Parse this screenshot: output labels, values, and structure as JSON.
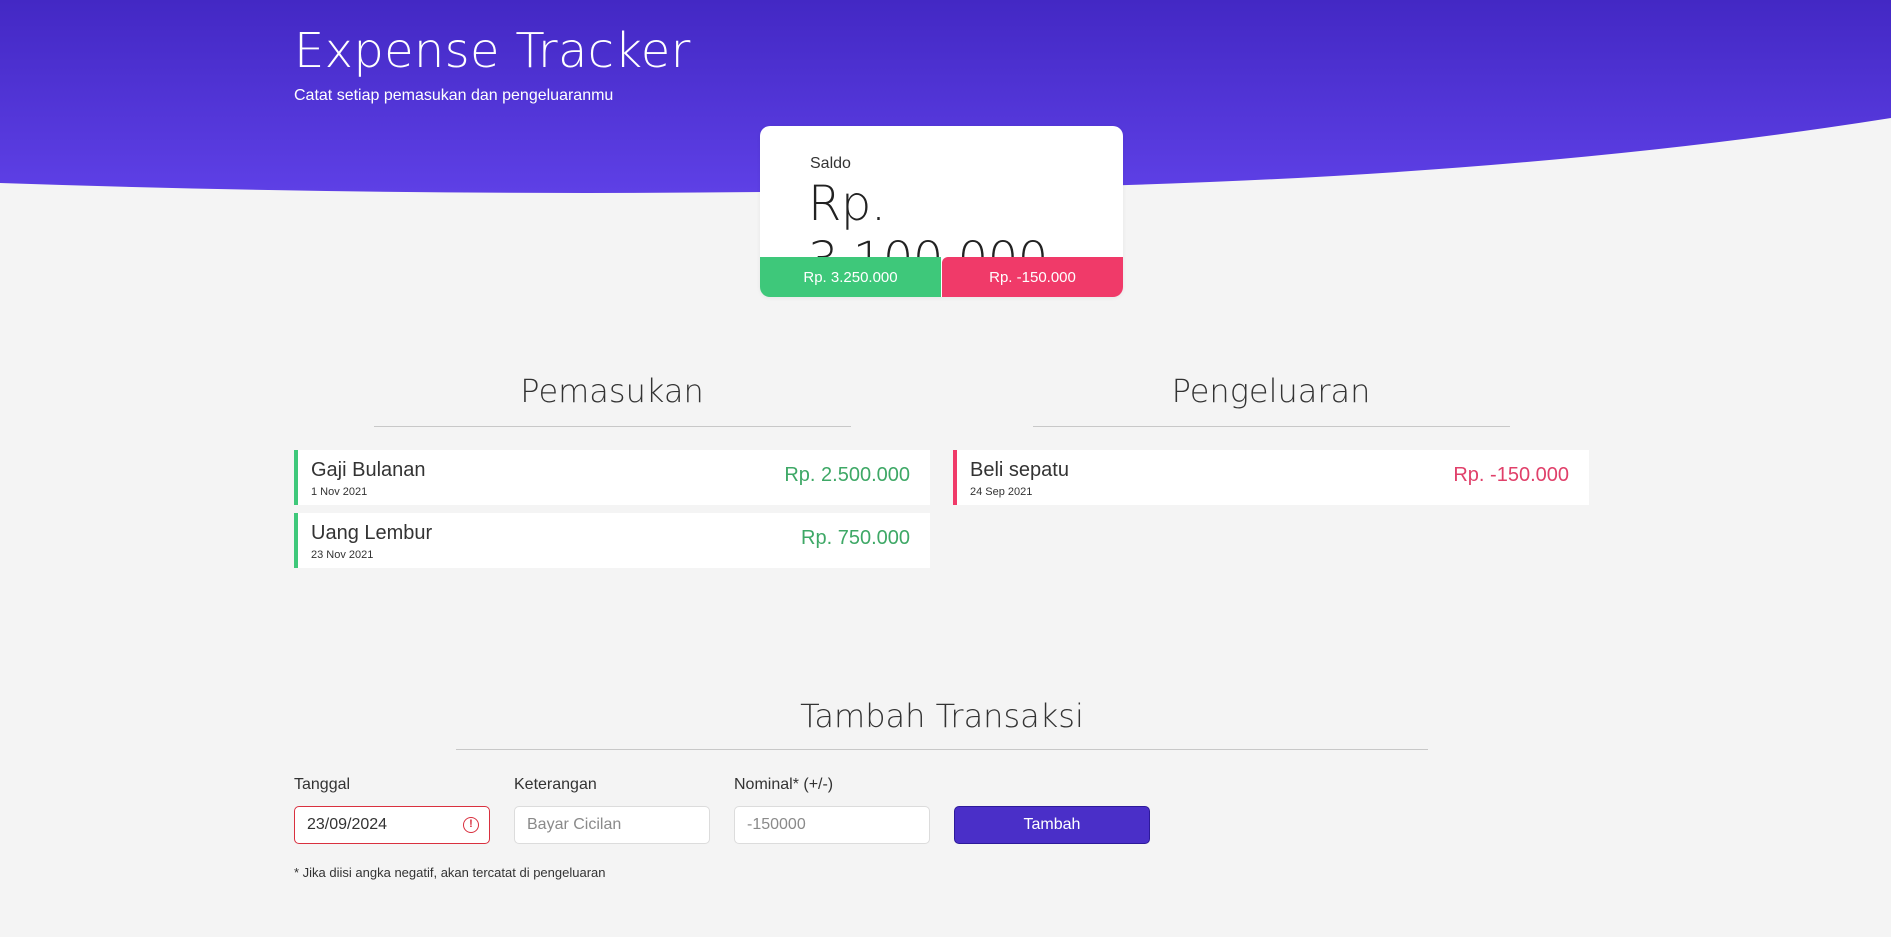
{
  "header": {
    "title": "Expense Tracker",
    "subtitle": "Catat setiap pemasukan dan pengeluaranmu"
  },
  "balance": {
    "label": "Saldo",
    "value": "Rp. 3.100.000",
    "income_total": "Rp. 3.250.000",
    "expense_total": "Rp. -150.000"
  },
  "income": {
    "title": "Pemasukan",
    "items": [
      {
        "name": "Gaji Bulanan",
        "date": "1 Nov 2021",
        "amount": "Rp. 2.500.000"
      },
      {
        "name": "Uang Lembur",
        "date": "23 Nov 2021",
        "amount": "Rp. 750.000"
      }
    ]
  },
  "expense": {
    "title": "Pengeluaran",
    "items": [
      {
        "name": "Beli sepatu",
        "date": "24 Sep 2021",
        "amount": "Rp. -150.000"
      }
    ]
  },
  "form": {
    "title": "Tambah Transaksi",
    "date_label": "Tanggal",
    "date_value": "23/09/2024",
    "desc_label": "Keterangan",
    "desc_placeholder": "Bayar Cicilan",
    "amount_label": "Nominal* (+/-)",
    "amount_placeholder": "-150000",
    "submit_label": "Tambah",
    "note": "* Jika diisi angka negatif, akan tercatat di pengeluaran"
  },
  "colors": {
    "hero_top": "#4328c4",
    "hero_bottom": "#5e40e6",
    "income": "#3ec87a",
    "expense": "#f03a69",
    "button": "#4a2fc8"
  }
}
